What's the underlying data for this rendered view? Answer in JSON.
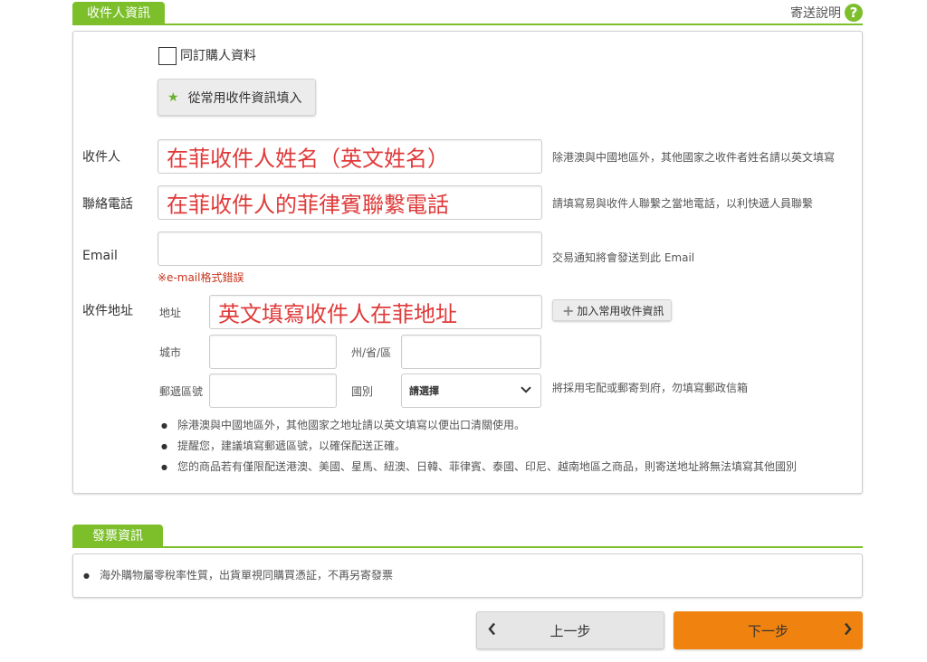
{
  "recipient_section": {
    "tab_label": "收件人資訊",
    "help_label": "寄送說明",
    "help_icon": "question-circle-icon",
    "same_as_buyer_label": "同訂購人資料",
    "fill_from_saved_label": "從常用收件資訊填入"
  },
  "fields": {
    "name": {
      "label": "收件人",
      "value": "在菲收件人姓名（英文姓名）",
      "hint": "除港澳與中國地區外，其他國家之收件者姓名請以英文填寫"
    },
    "phone": {
      "label": "聯絡電話",
      "value": "在菲收件人的菲律賓聯繫電話",
      "hint": "請填寫易與收件人聯繫之當地電話，以利快遞人員聯繫"
    },
    "email": {
      "label": "Email",
      "value": "",
      "hint": "交易通知將會發送到此 Email",
      "error": "※e-mail格式錯誤"
    },
    "address": {
      "label": "收件地址",
      "addr_label": "地址",
      "addr_value": "英文填寫收件人在菲地址",
      "add_saved_label": "加入常用收件資訊",
      "city_label": "城市",
      "state_label": "州/省/區",
      "zip_label": "郵遞區號",
      "country_label": "國別",
      "country_selected": "請選擇",
      "delivery_hint": "將採用宅配或郵寄到府，勿填寫郵政信箱"
    }
  },
  "notes": [
    "除港澳與中國地區外，其他國家之地址請以英文填寫以便出口清關使用。",
    "提醒您，建議填寫郵遞區號，以確保配送正確。",
    "您的商品若有僅限配送港澳、美國、星馬、紐澳、日韓、菲律賓、泰國、印尼、越南地區之商品，則寄送地址將無法填寫其他國別"
  ],
  "invoice_section": {
    "tab_label": "發票資訊",
    "note": "海外購物屬零稅率性質，出貨單視同購買憑証，不再另寄發票"
  },
  "navigation": {
    "prev_label": "上一步",
    "next_label": "下一步"
  },
  "colors": {
    "accent_green": "#7cbf2b",
    "next_orange": "#f0830f",
    "value_red": "#e03a3a"
  }
}
